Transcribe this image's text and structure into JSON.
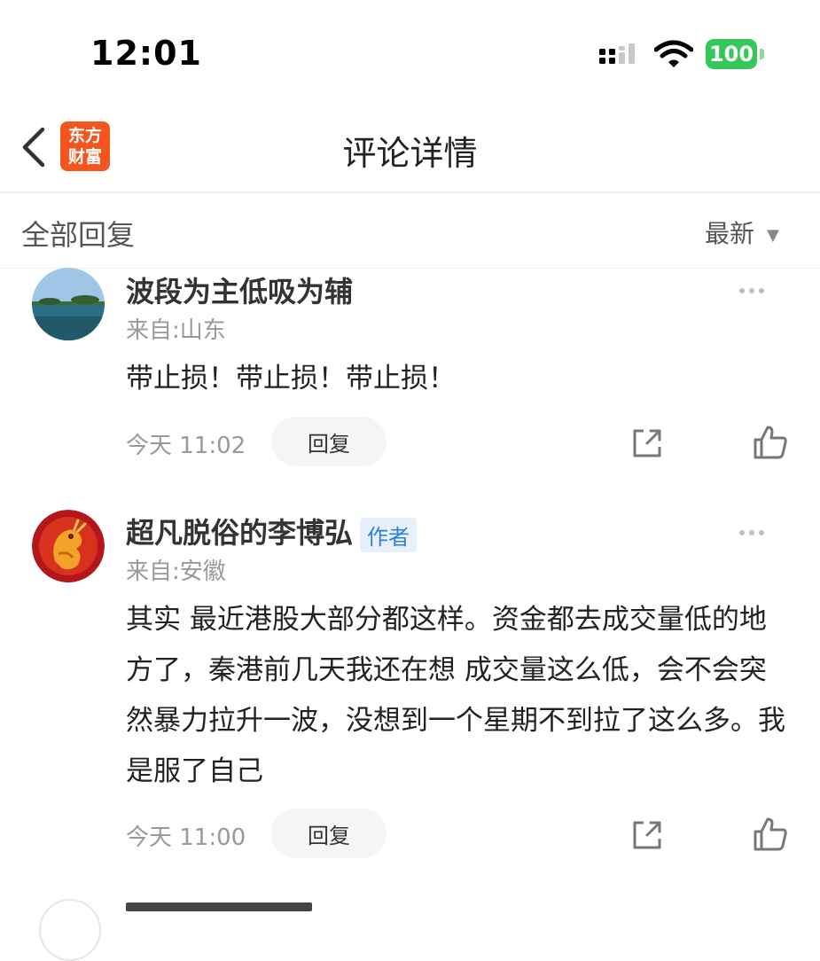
{
  "status_bar": {
    "time": "12:01",
    "battery": "100"
  },
  "nav": {
    "title": "评论详情",
    "logo_line1": "东方",
    "logo_line2": "财富"
  },
  "reply_header": {
    "title": "全部回复",
    "sort_label": "最新"
  },
  "comments": [
    {
      "username": "波段为主低吸为辅",
      "location": "来自:山东",
      "content": "带止损！带止损！带止损！",
      "time": "今天 11:02",
      "reply_label": "回复",
      "is_author": false
    },
    {
      "username": "超凡脱俗的李博弘",
      "author_badge": "作者",
      "location": "来自:安徽",
      "content": "其实 最近港股大部分都这样。资金都去成交量低的地方了，秦港前几天我还在想 成交量这么低，会不会突然暴力拉升一波，没想到一个星期不到拉了这么多。我是服了自己",
      "time": "今天 11:00",
      "reply_label": "回复",
      "is_author": true
    }
  ],
  "colors": {
    "accent_logo": "#f4541e",
    "battery": "#34c759",
    "author_badge_text": "#2f7fd6"
  }
}
